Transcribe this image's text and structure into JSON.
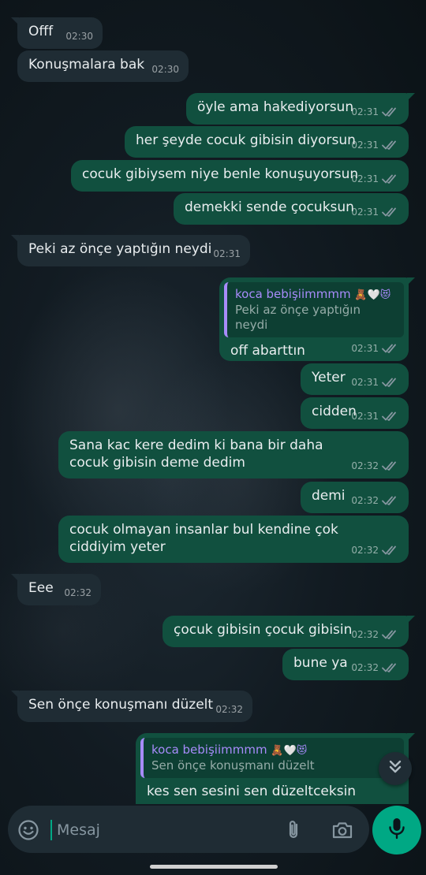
{
  "messages": [
    {
      "dir": "in",
      "text": "Offf",
      "time": "02:30",
      "tail": true
    },
    {
      "dir": "in",
      "text": "Konuşmalara bak",
      "time": "02:30",
      "tail": false
    },
    {
      "dir": "out",
      "text": "öyle ama hakediyorsun",
      "time": "02:31",
      "tail": true
    },
    {
      "dir": "out",
      "text": "her şeyde cocuk gibisin diyorsun",
      "time": "02:31",
      "tail": false
    },
    {
      "dir": "out",
      "text": "cocuk gibiysem niye benle konuşuyorsun",
      "time": "02:31",
      "tail": false
    },
    {
      "dir": "out",
      "text": "demekki sende çocuksun",
      "time": "02:31",
      "tail": false
    },
    {
      "dir": "in",
      "text": "Peki az önçe yaptığın neydi",
      "time": "02:31",
      "tail": true
    },
    {
      "dir": "out",
      "text": "off abarttın",
      "time": "02:31",
      "tail": true,
      "quote": {
        "name": "koca bebişiimmmm",
        "emojis": "🧸🤍😻",
        "text": "Peki az önçe yaptığın neydi"
      }
    },
    {
      "dir": "out",
      "text": "Yeter",
      "time": "02:31",
      "tail": false
    },
    {
      "dir": "out",
      "text": "cidden",
      "time": "02:31",
      "tail": false
    },
    {
      "dir": "out",
      "text": "Sana kac kere dedim ki bana bir daha cocuk gibisin deme dedim",
      "time": "02:32",
      "tail": false
    },
    {
      "dir": "out",
      "text": "demi",
      "time": "02:32",
      "tail": false
    },
    {
      "dir": "out",
      "text": "cocuk olmayan insanlar bul kendine çok ciddiyim yeter",
      "time": "02:32",
      "tail": false
    },
    {
      "dir": "in",
      "text": "Eee",
      "time": "02:32",
      "tail": true
    },
    {
      "dir": "out",
      "text": "çocuk gibisin çocuk gibisin",
      "time": "02:32",
      "tail": true
    },
    {
      "dir": "out",
      "text": "bune ya",
      "time": "02:32",
      "tail": false
    },
    {
      "dir": "in",
      "text": "Sen önçe konuşmanı düzelt",
      "time": "02:32",
      "tail": true
    },
    {
      "dir": "out",
      "text": "kes sen sesini sen düzeltceksin",
      "time": "",
      "tail": true,
      "quote": {
        "name": "koca bebişiimmmm",
        "emojis": "🧸🤍😻",
        "text": "Sen önçe konuşmanı düzelt"
      }
    }
  ],
  "composer": {
    "placeholder": "Mesaj"
  },
  "colors": {
    "incoming": "#1f2c34",
    "outgoing": "#11503f",
    "accent": "#00a884",
    "quote_bar": "#a78bfa",
    "read_ticks": "#8696a0"
  },
  "icons": {
    "emoji": "emoji-icon",
    "attach": "paperclip-icon",
    "camera": "camera-icon",
    "mic": "mic-icon",
    "scroll": "double-chevron-down-icon",
    "read": "double-check-icon"
  }
}
